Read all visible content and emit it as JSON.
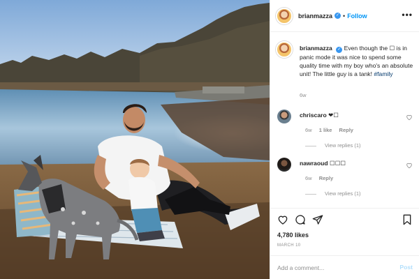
{
  "post": {
    "username": "brianmazza",
    "follow_label": "Follow",
    "separator": "•",
    "more_label": "•••",
    "caption_text": "Even though the ☐ is in panic mode it was nice to spend some quality time with my boy who's an absolute unit! The little guy is a tank!",
    "hashtag": "#family",
    "caption_time": "6w",
    "likes": "4,780 likes",
    "date": "MARCH 10"
  },
  "comments": [
    {
      "username": "chriscaro",
      "text": "❤☐",
      "time": "6w",
      "likes": "1 like",
      "reply": "Reply",
      "view_replies": "View replies (1)"
    },
    {
      "username": "nawraoud",
      "text": "☐☐☐",
      "time": "6w",
      "reply": "Reply",
      "view_replies": "View replies (1)"
    }
  ],
  "add_comment": {
    "placeholder": "Add a comment...",
    "post_label": "Post"
  },
  "icons": {
    "like": "heart-icon",
    "comment": "comment-bubble-icon",
    "share": "paper-plane-icon",
    "save": "bookmark-icon",
    "more": "more-dots-icon",
    "verified": "verified-badge-icon"
  },
  "colors": {
    "link": "#0095f6",
    "verified": "#3897f0",
    "post_disabled": "#b2dffc",
    "secondary_text": "#8e8e8e"
  }
}
